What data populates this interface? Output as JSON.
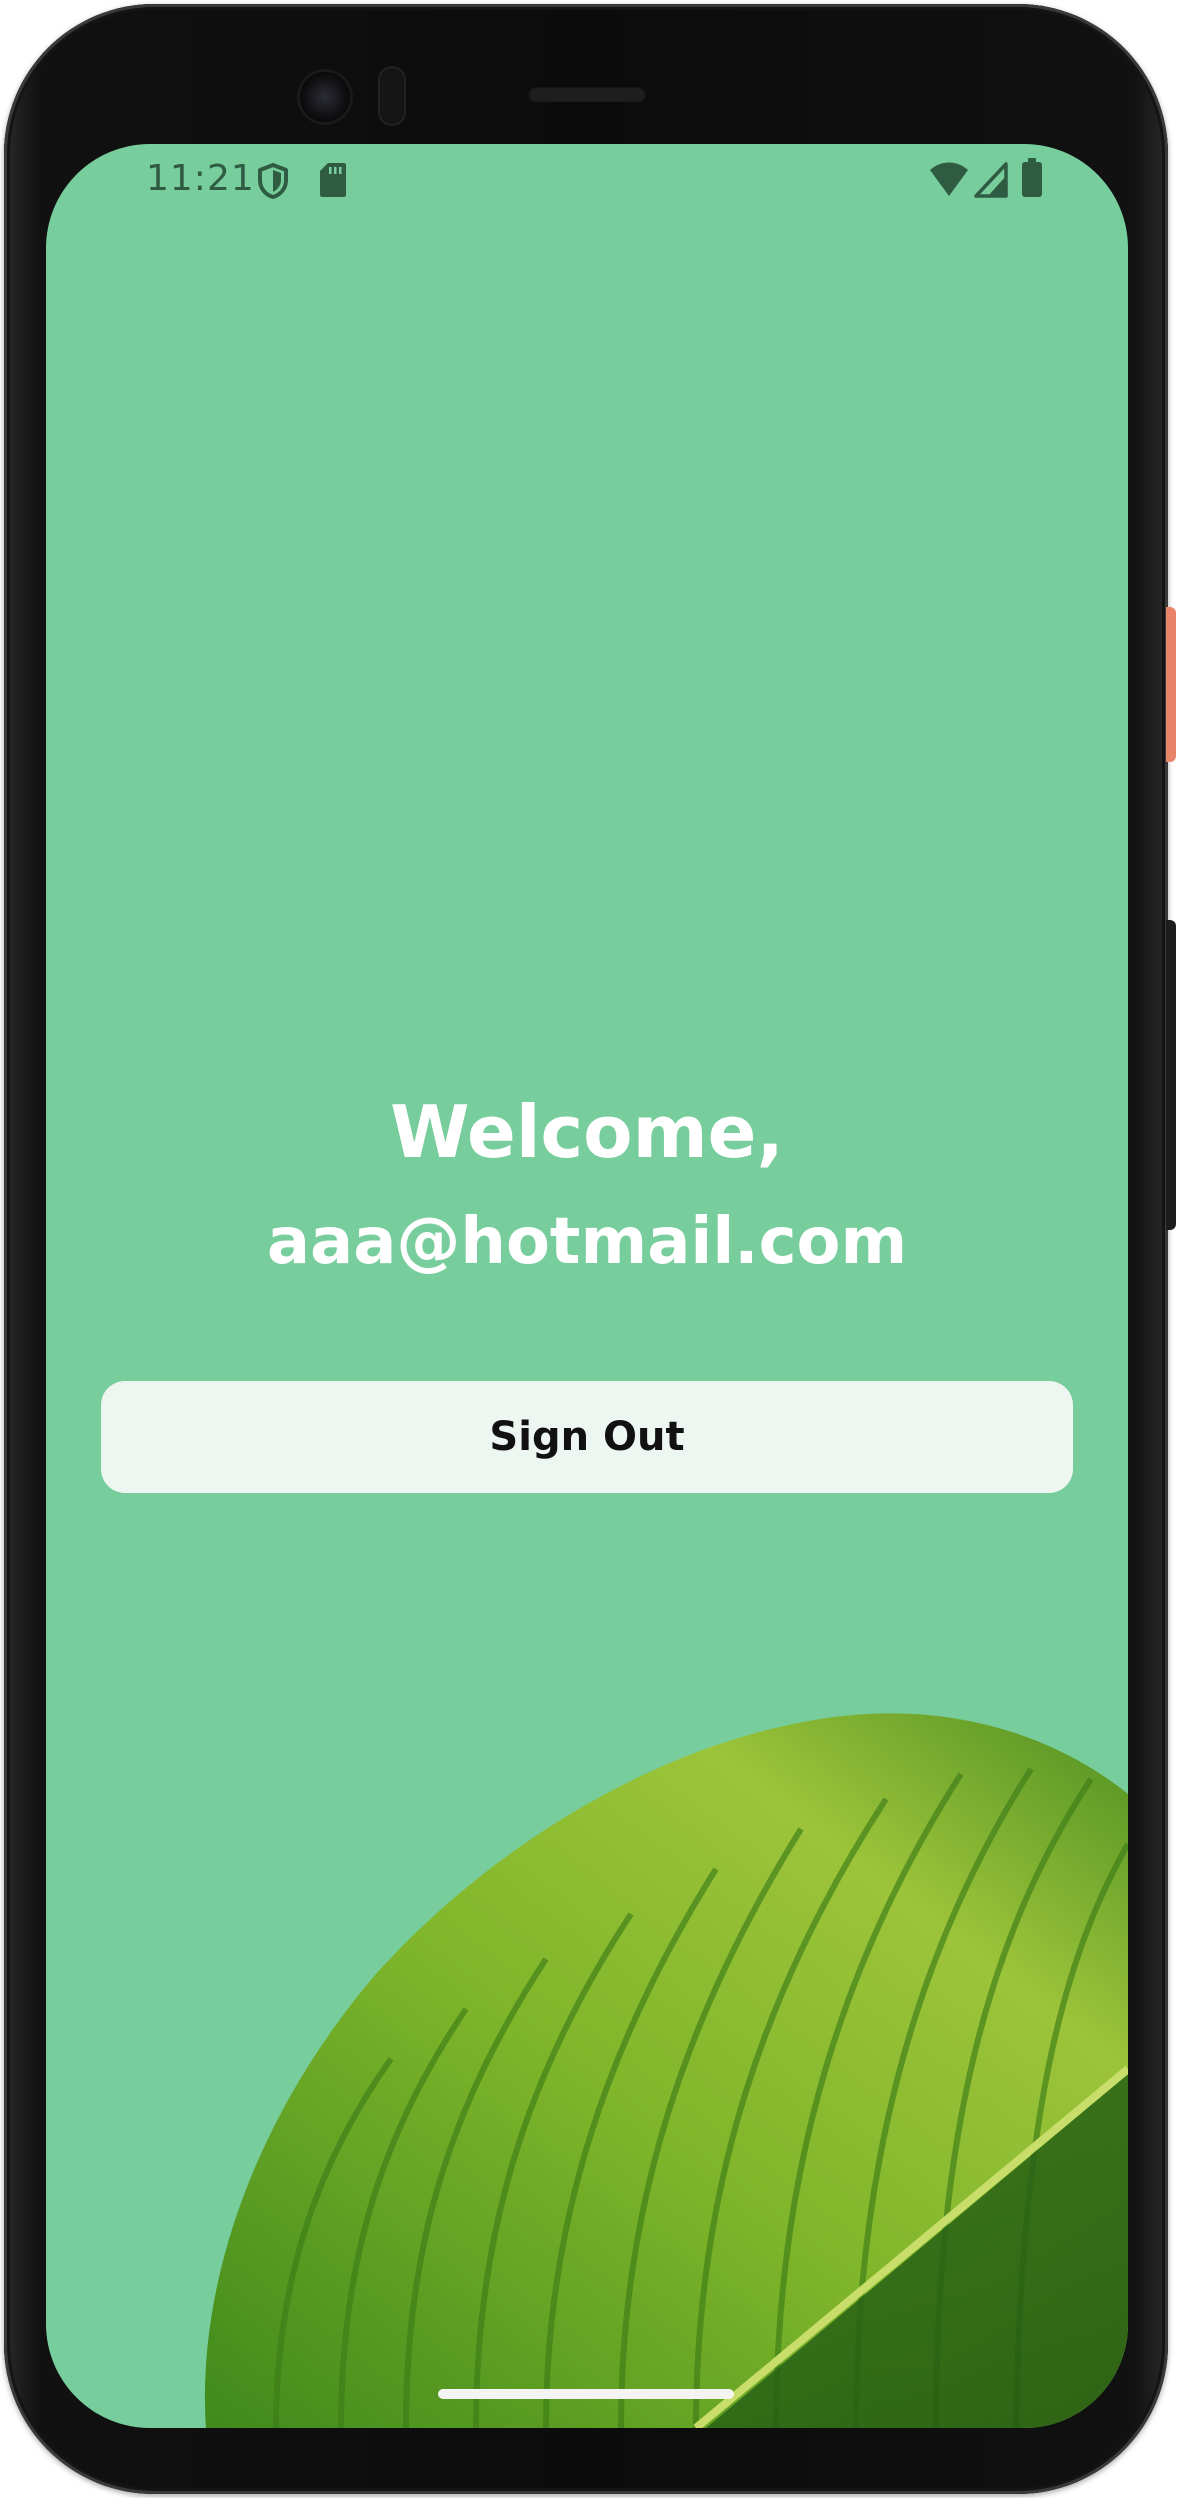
{
  "status_bar": {
    "time": "11:21",
    "left_icons": [
      "shield-icon",
      "sd-card-icon"
    ],
    "right_icons": [
      "wifi-icon",
      "cellular-signal-icon",
      "battery-icon"
    ]
  },
  "welcome": {
    "greeting": "Welcome,",
    "email": "aaa@hotmail.com"
  },
  "sign_out_button": {
    "label": "Sign Out"
  },
  "decoration": {
    "image": "green-leaf-illustration"
  },
  "colors": {
    "background": "#77cd9b",
    "button_background": "#eef6f1",
    "text_on_background": "#ffffff",
    "button_text": "#111111",
    "status_icons": "#2f5b43"
  }
}
